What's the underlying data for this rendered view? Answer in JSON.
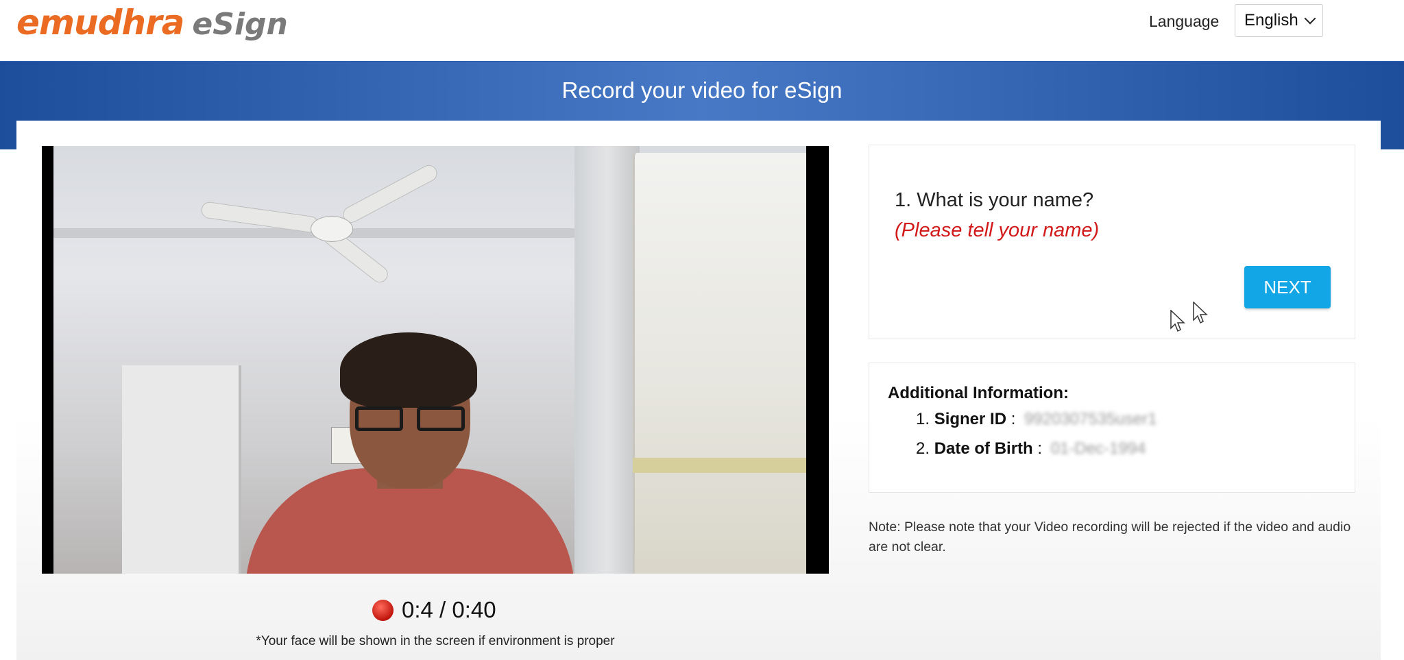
{
  "header": {
    "logo_main": "emudhra",
    "logo_sub": "eSign",
    "language_label": "Language",
    "language_selected": "English"
  },
  "banner": {
    "title": "Record your video for eSign"
  },
  "recorder": {
    "time": "0:4 / 0:40",
    "note": "*Your face will be shown in the screen if environment is proper"
  },
  "question": {
    "text": "1. What is your name?",
    "hint": "(Please tell your name)",
    "next_label": "NEXT"
  },
  "additional_info": {
    "title": "Additional Information:",
    "items": [
      {
        "number": "1.",
        "label": "Signer ID",
        "separator": ":",
        "value": "9920307535user1"
      },
      {
        "number": "2.",
        "label": "Date of Birth",
        "separator": ":",
        "value": "01-Dec-1994"
      }
    ]
  },
  "note": "Note: Please note that your Video recording will be rejected if the video and audio are not clear.",
  "colors": {
    "brand_orange": "#ea6b21",
    "banner_blue": "#2c5fa8",
    "next_button": "#12a6e6",
    "hint_red": "#d21a1a"
  }
}
